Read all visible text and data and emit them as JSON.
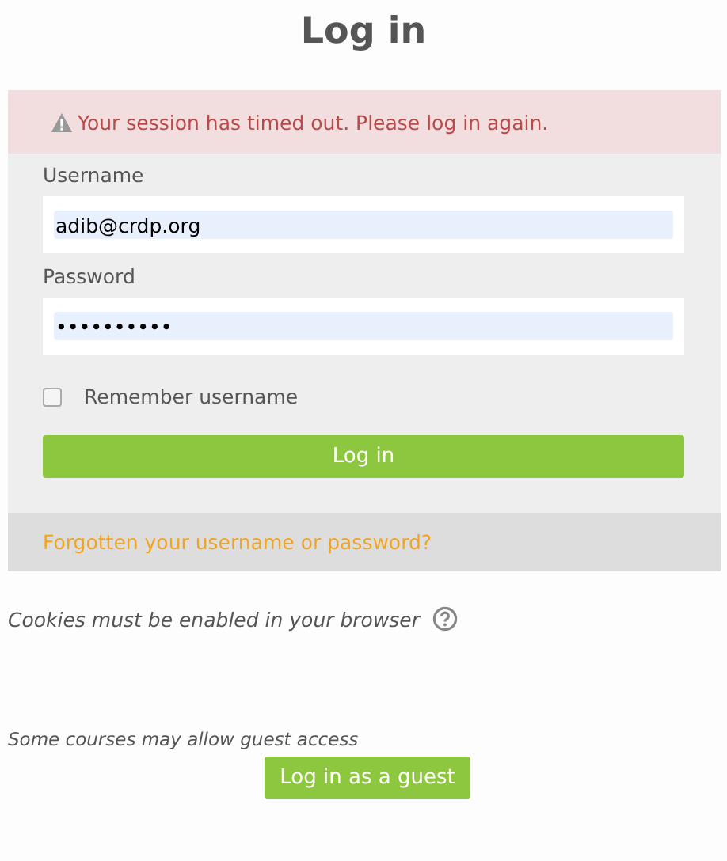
{
  "title": "Log in",
  "alert": {
    "kind": "warning",
    "message": "Your session has timed out. Please log in again."
  },
  "form": {
    "fields": [
      {
        "label": "Username",
        "value": "adib@crdp.org"
      },
      {
        "label": "Password",
        "value": "••••••••••"
      }
    ],
    "remember": {
      "label": "Remember username",
      "checked": false
    },
    "submit": "Log in"
  },
  "forgot_link": "Forgotten your username or password?",
  "cookies_note": "Cookies must be enabled in your browser",
  "guest_note": "Some courses may allow guest access",
  "guest_button": "Log in as a guest"
}
